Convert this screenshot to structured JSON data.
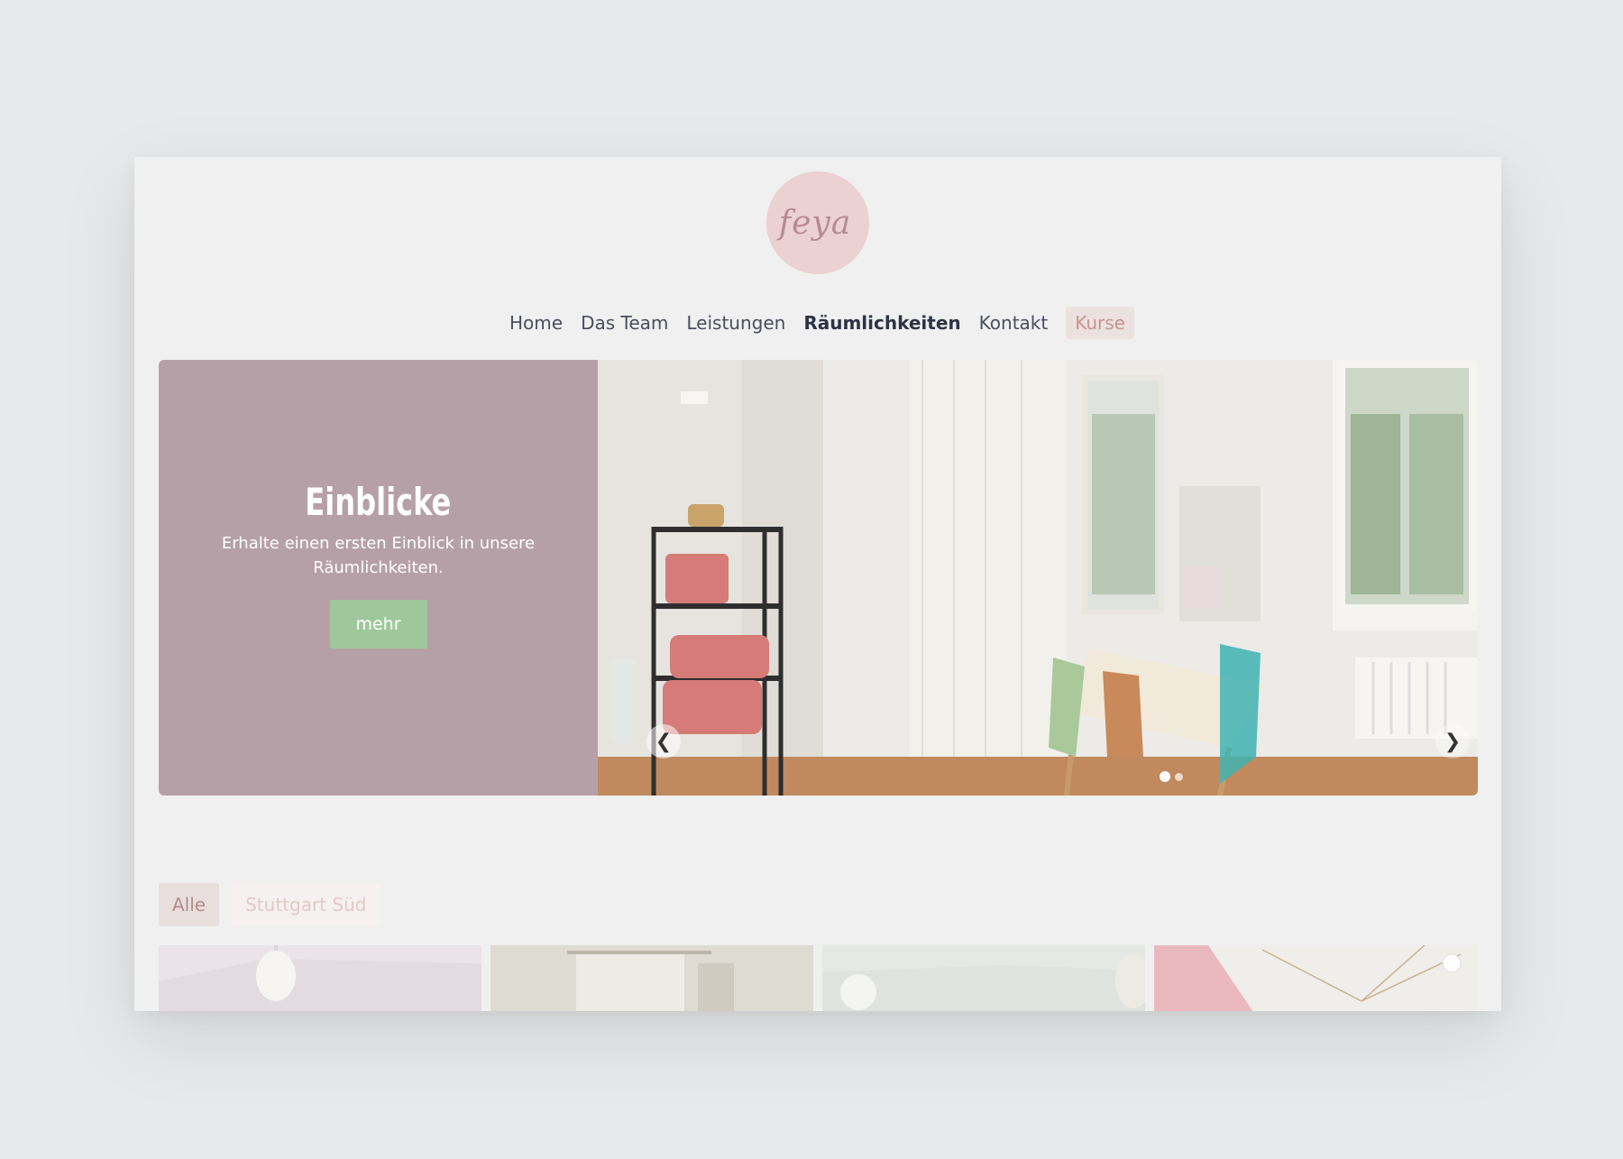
{
  "logo": {
    "text": "feya"
  },
  "nav": {
    "items": [
      {
        "label": "Home"
      },
      {
        "label": "Das Team"
      },
      {
        "label": "Leistungen"
      },
      {
        "label": "Räumlichkeiten"
      },
      {
        "label": "Kontakt"
      },
      {
        "label": "Kurse"
      }
    ],
    "active": "Räumlichkeiten"
  },
  "hero": {
    "title": "Einblicke",
    "subtitle": "Erhalte einen ersten Einblick in unsere Räumlichkeiten.",
    "button_label": "mehr",
    "slide_count": 2,
    "current_slide": 1
  },
  "filters": {
    "items": [
      {
        "label": "Alle"
      },
      {
        "label": "Stuttgart Süd"
      }
    ]
  },
  "icons": {
    "prev": "chevron-left-icon",
    "next": "chevron-right-icon"
  },
  "colors": {
    "background": "#e7e9ea",
    "card": "#f0f0f0",
    "hero_panel": "#b6a0a8",
    "button": "#9ec89c",
    "logo_circle": "#ebd1d2",
    "accent_text": "#c8938f"
  }
}
